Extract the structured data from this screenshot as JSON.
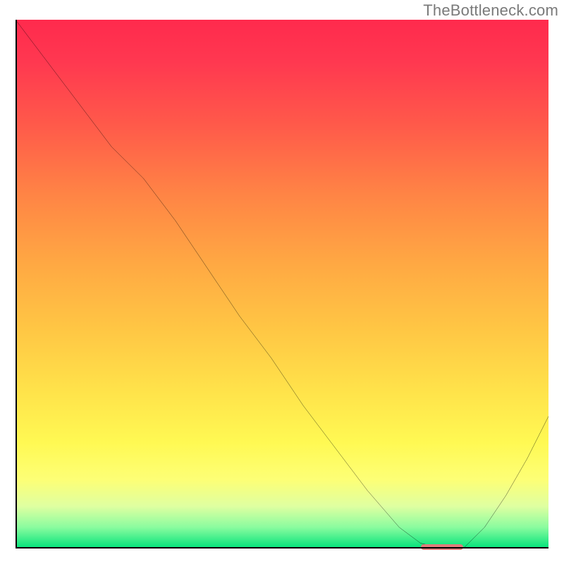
{
  "watermark": "TheBottleneck.com",
  "chart_data": {
    "type": "line",
    "title": "",
    "xlabel": "",
    "ylabel": "",
    "xlim": [
      0,
      100
    ],
    "ylim": [
      0,
      100
    ],
    "x": [
      0,
      6,
      12,
      18,
      24,
      30,
      36,
      42,
      48,
      54,
      60,
      66,
      72,
      76,
      80,
      84,
      88,
      92,
      96,
      100
    ],
    "values": [
      100,
      92,
      84,
      76,
      70,
      62,
      53,
      44,
      36,
      27,
      19,
      11,
      4,
      1,
      0,
      0,
      4,
      10,
      17,
      25
    ],
    "optimum_range_x": [
      76,
      84
    ],
    "gradient_stops": [
      {
        "pct": 0,
        "color": "#ff2a4d"
      },
      {
        "pct": 50,
        "color": "#ffb944"
      },
      {
        "pct": 80,
        "color": "#fff953"
      },
      {
        "pct": 100,
        "color": "#00e27a"
      }
    ],
    "optimum_marker_color": "#e07a7a",
    "curve_color": "#000000"
  }
}
